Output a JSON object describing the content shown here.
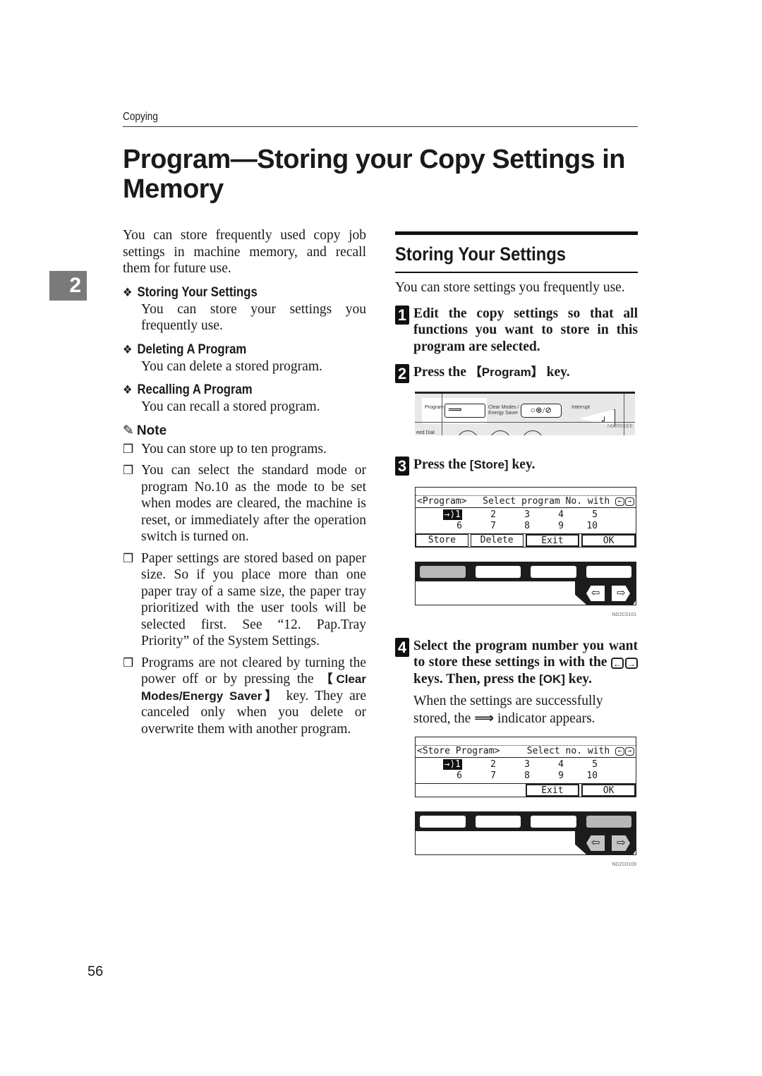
{
  "header": {
    "section": "Copying",
    "title": "Program—Storing your Copy Settings in Memory"
  },
  "chapter_tab": "2",
  "left": {
    "intro": "You can store frequently used copy job settings in machine memory, and recall them for future use.",
    "subsections": [
      {
        "icon": "diamond-bullet-icon",
        "heading": "Storing Your Settings",
        "body": "You can store your settings you frequently use."
      },
      {
        "icon": "diamond-bullet-icon",
        "heading": "Deleting A Program",
        "body": "You can delete a stored program."
      },
      {
        "icon": "diamond-bullet-icon",
        "heading": "Recalling A Program",
        "body": "You can recall a stored program."
      }
    ],
    "note": {
      "icon": "pencil-icon",
      "heading": "Note",
      "items": [
        "You can store up to ten programs.",
        "You can select the standard mode or program No.10 as the mode to be set when modes are cleared, the machine is reset, or immediately after the operation switch is turned on.",
        "Paper settings are stored based on paper size. So if you place more than one paper tray of a same size, the paper tray prioritized with the user tools will be selected first. See “12. Pap.Tray Priority” of the System Settings.",
        {
          "before": "Programs are not cleared by turning the power off or by pressing the ",
          "key": "【Clear Modes/Energy Saver】",
          "after": " key. They are canceled only when you delete or overwrite them with another program."
        }
      ]
    }
  },
  "right": {
    "section_title": "Storing Your Settings",
    "intro": "You can store settings you frequently use.",
    "steps": [
      {
        "num": "1",
        "text": "Edit the copy settings so that all functions you want to store in this program are selected."
      },
      {
        "num": "2",
        "before": "Press the ",
        "key": "【Program】",
        "after": " key."
      },
      {
        "num": "3",
        "before": "Press the ",
        "key": "[Store]",
        "after": " key."
      },
      {
        "num": "4",
        "before": "Select the program number you want to store these settings in with the ",
        "after": " keys. Then, press the ",
        "key": "[OK]",
        "end": " key.",
        "note_before": "When the settings are successfully stored, the ",
        "note_after": " indicator appears."
      }
    ],
    "panel": {
      "program_label": "Program",
      "clear_label_1": "Clear Modes /",
      "clear_label_2": "Energy Saver",
      "interrupt_label": "Interrupt",
      "speed_dial_label": "eed Dial",
      "code": "ND2R01EE"
    },
    "lcd1": {
      "title": "<Program>",
      "prompt": "Select program No. with",
      "numbers": [
        "→⟩1",
        "2",
        "3",
        "4",
        "5",
        "6",
        "7",
        "8",
        "9",
        "10"
      ],
      "buttons": [
        "Store",
        "Delete",
        "Exit",
        "OK"
      ],
      "figure_code": "ND2C0101"
    },
    "lcd2": {
      "title": "<Store Program>",
      "prompt": "Select no. with",
      "numbers": [
        "→⟩1",
        "2",
        "3",
        "4",
        "5",
        "6",
        "7",
        "8",
        "9",
        "10"
      ],
      "buttons": [
        "",
        "",
        "Exit",
        "OK"
      ],
      "figure_code": "ND2C0109"
    }
  },
  "page_number": "56"
}
